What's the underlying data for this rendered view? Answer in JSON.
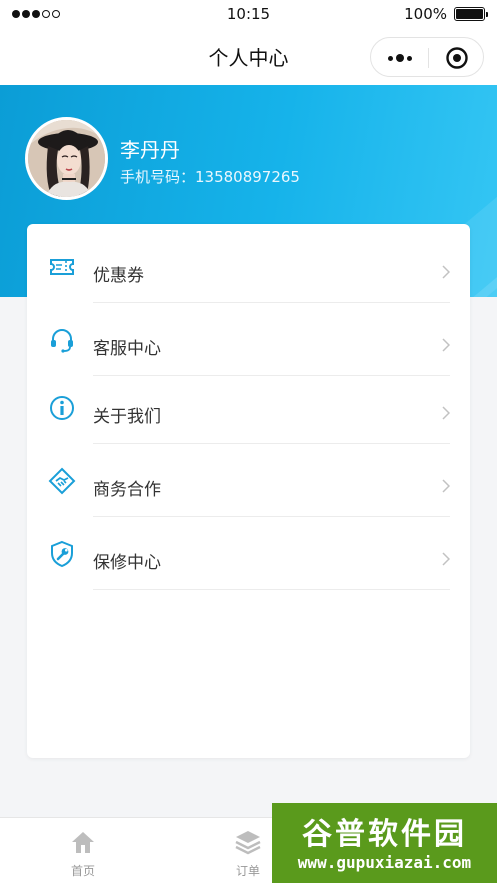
{
  "status_bar": {
    "time": "10:15",
    "battery_label": "100%",
    "battery_level": 1.0,
    "signal_bars_filled": 3,
    "signal_bars_total": 5
  },
  "nav": {
    "title": "个人中心",
    "more_icon": "more-dots-icon",
    "close_icon": "target-close-icon"
  },
  "profile": {
    "name": "李丹丹",
    "phone_label": "手机号码：",
    "phone": "13580897265",
    "phone_full": "手机号码：13580897265"
  },
  "menu": {
    "items": [
      {
        "label": "优惠券",
        "icon": "ticket-icon"
      },
      {
        "label": "客服中心",
        "icon": "headset-icon"
      },
      {
        "label": "关于我们",
        "icon": "info-icon"
      },
      {
        "label": "商务合作",
        "icon": "handshake-icon"
      },
      {
        "label": "保修中心",
        "icon": "shield-wrench-icon"
      }
    ]
  },
  "tabbar": {
    "items": [
      {
        "label": "首页",
        "icon": "home-icon"
      },
      {
        "label": "订单",
        "icon": "layers-icon"
      }
    ]
  },
  "watermark": {
    "title": "谷普软件园",
    "url": "www.gupuxiazai.com"
  },
  "colors": {
    "accent": "#0b9dd6",
    "accent_light": "#35c6f4",
    "watermark": "#5a9a1c"
  }
}
